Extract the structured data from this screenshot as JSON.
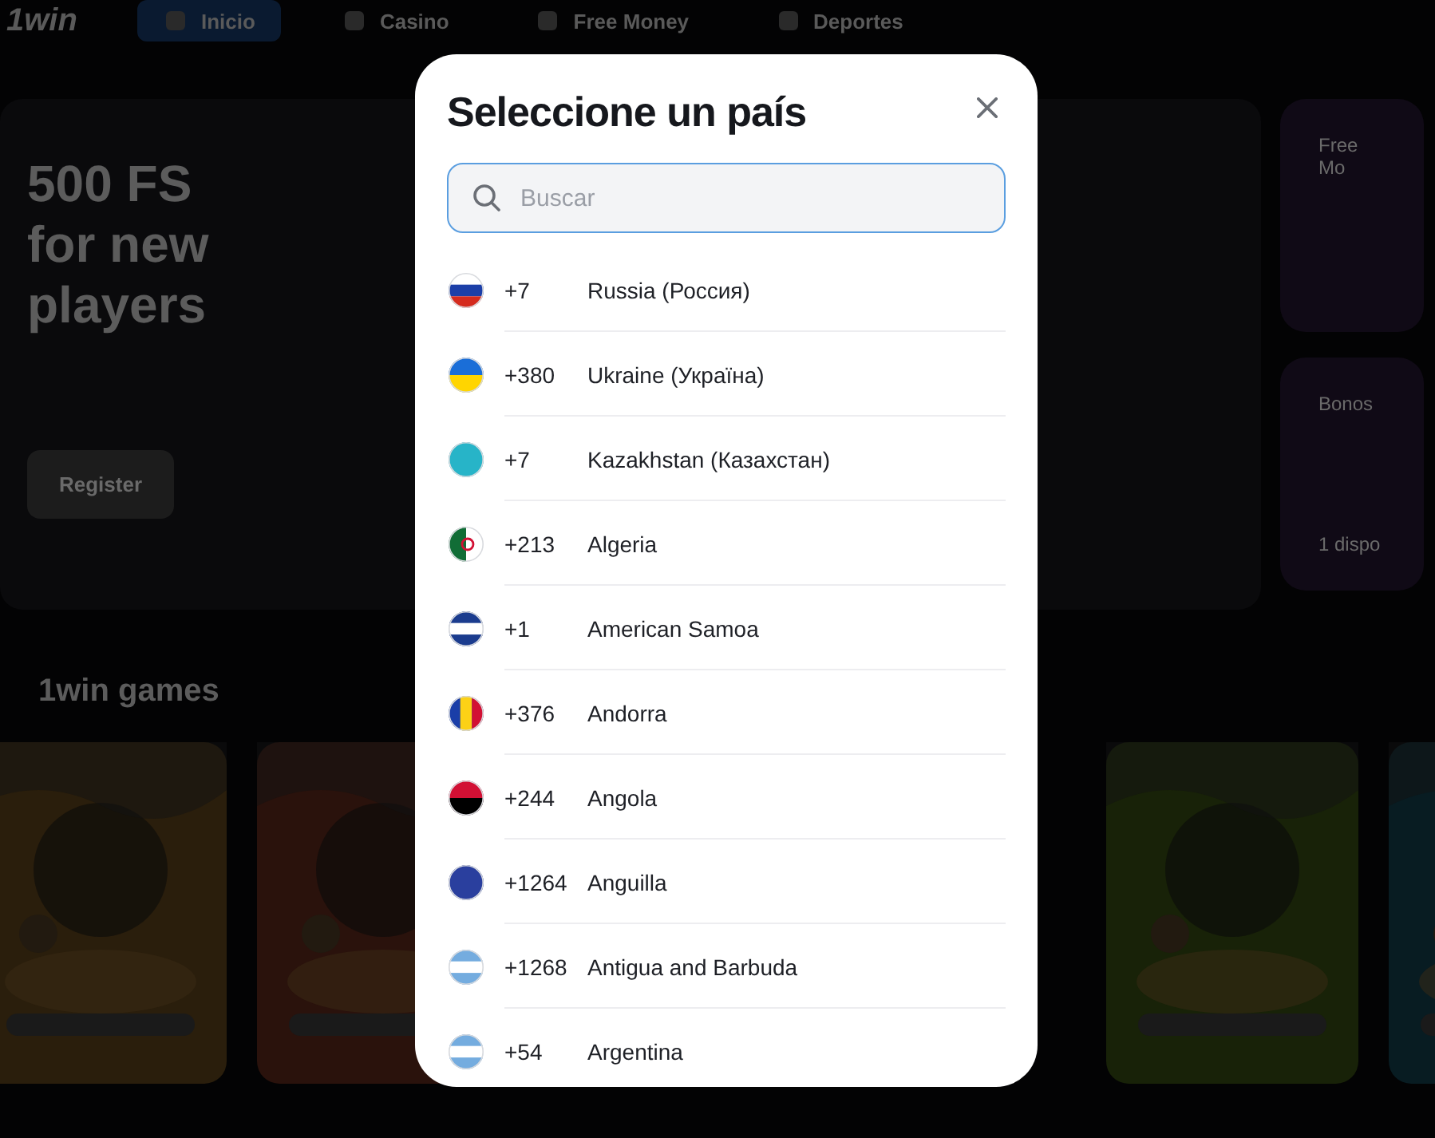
{
  "background": {
    "logo": "1win",
    "nav": [
      {
        "label": "Inicio",
        "selected": true
      },
      {
        "label": "Casino",
        "selected": false
      },
      {
        "label": "Free Money",
        "selected": false
      },
      {
        "label": "Deportes",
        "selected": false
      }
    ],
    "hero": {
      "title": "500 FS for new players",
      "button": "Register"
    },
    "side_cards": [
      {
        "title": "Free Mo"
      },
      {
        "title": "Bonos",
        "note": "1 dispo"
      }
    ],
    "section_title": "1win games"
  },
  "dialog": {
    "title": "Seleccione un país",
    "search": {
      "placeholder": "Buscar"
    },
    "countries": [
      {
        "code": "+7",
        "name": "Russia (Россия)"
      },
      {
        "code": "+380",
        "name": "Ukraine (Україна)"
      },
      {
        "code": "+7",
        "name": "Kazakhstan (Казахстан)"
      },
      {
        "code": "+213",
        "name": "Algeria"
      },
      {
        "code": "+1",
        "name": "American Samoa"
      },
      {
        "code": "+376",
        "name": "Andorra"
      },
      {
        "code": "+244",
        "name": "Angola"
      },
      {
        "code": "+1264",
        "name": "Anguilla"
      },
      {
        "code": "+1268",
        "name": "Antigua and Barbuda"
      },
      {
        "code": "+54",
        "name": "Argentina"
      }
    ]
  }
}
